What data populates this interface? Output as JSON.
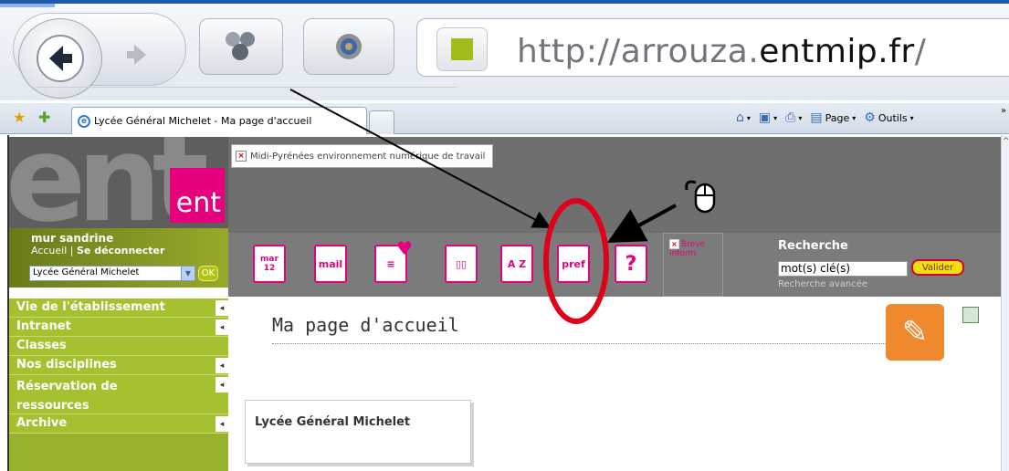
{
  "browser": {
    "url_prefix": "http://arrouza.",
    "url_domain": "entmip.fr",
    "url_suffix": "/",
    "tab_title": "Lycée Général Michelet - Ma page d'accueil",
    "commands": {
      "page": "Page",
      "tools": "Outils"
    },
    "icons": [
      "back-arrow-icon",
      "forward-arrow-icon",
      "compatibility-icon",
      "feed-icon",
      "site-icon",
      "favorites-star-icon",
      "add-favorite-icon",
      "home-icon",
      "rss-icon",
      "print-icon",
      "page-icon",
      "tools-gear-icon"
    ]
  },
  "banner": {
    "broken_image_alt": "Midi-Pyrénées environnement numérique de travail",
    "logo_text": "ent",
    "logo_box_text": "ent"
  },
  "user": {
    "name": "mur sandrine",
    "home_link": "Accueil",
    "separator": "|",
    "logout_link": "Se déconnecter",
    "school_select": "Lycée Général Michelet",
    "ok_label": "OK"
  },
  "tools": {
    "calendar_label": "mar\n12",
    "mail_label": "mail",
    "pref_label": "pref",
    "help_label": "?",
    "directory_label": "A Z",
    "brief_label": "Breve inform"
  },
  "search": {
    "label": "Recherche",
    "input_value": "mot(s) clé(s)",
    "button": "Valider",
    "advanced": "Recherche avancée"
  },
  "sidebar": {
    "items": [
      {
        "label": "Vie de l'établissement",
        "has_arrow": true
      },
      {
        "label": "Intranet",
        "has_arrow": true
      },
      {
        "label": "Classes",
        "has_arrow": false
      },
      {
        "label": "Nos disciplines",
        "has_arrow": true
      },
      {
        "label": "Réservation de ressources",
        "has_arrow": true
      },
      {
        "label": "Archive",
        "has_arrow": true
      }
    ]
  },
  "main": {
    "title": "Ma page d'accueil",
    "card_title": "Lycée Général Michelet"
  },
  "colors": {
    "accent_pink": "#e6007e",
    "sidebar_green": "#a5c12f",
    "highlight_red": "#e0001a"
  }
}
